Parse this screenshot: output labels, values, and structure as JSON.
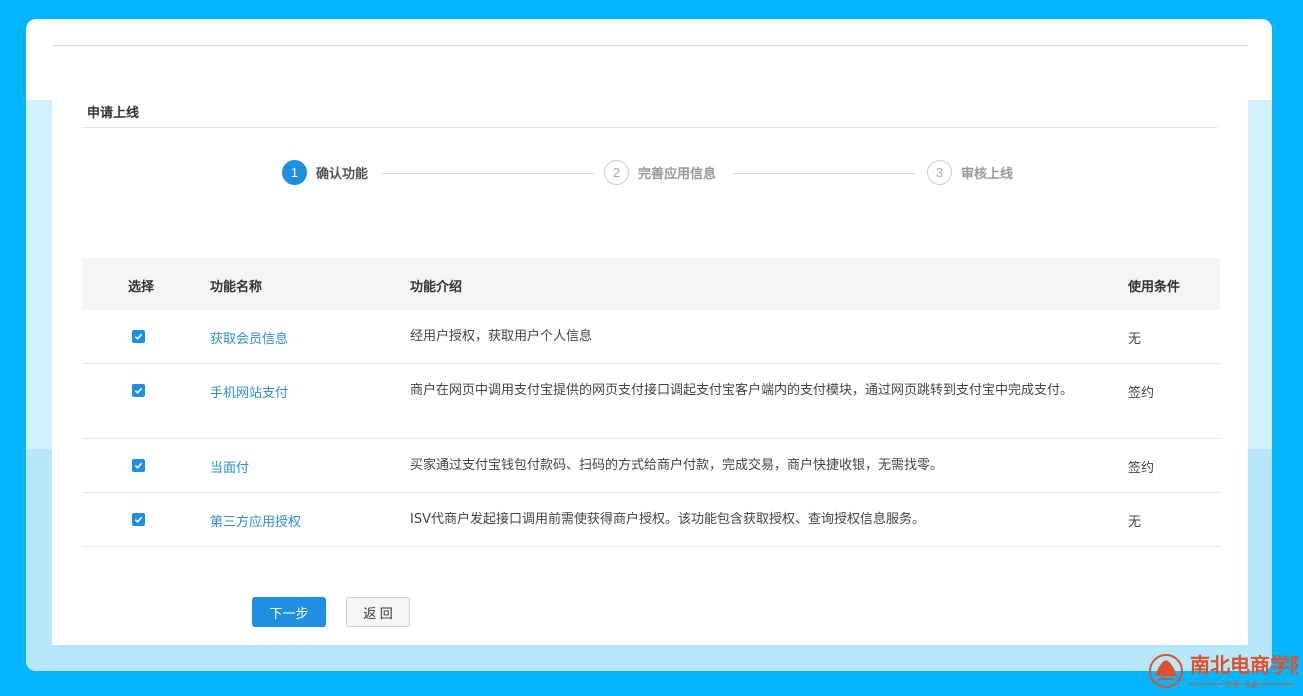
{
  "page": {
    "title": "申请上线"
  },
  "steps": [
    {
      "number": "1",
      "label": "确认功能",
      "state": "active"
    },
    {
      "number": "2",
      "label": "完善应用信息",
      "state": "inactive"
    },
    {
      "number": "3",
      "label": "审核上线",
      "state": "inactive"
    }
  ],
  "table": {
    "headers": {
      "select": "选择",
      "name": "功能名称",
      "desc": "功能介绍",
      "cond": "使用条件"
    },
    "rows": [
      {
        "checked": true,
        "name": "获取会员信息",
        "desc": "经用户授权，获取用户个人信息",
        "cond": "无"
      },
      {
        "checked": true,
        "name": "手机网站支付",
        "desc": "商户在网页中调用支付宝提供的网页支付接口调起支付宝客户端内的支付模块，通过网页跳转到支付宝中完成支付。",
        "cond": "签约"
      },
      {
        "checked": true,
        "name": "当面付",
        "desc": "买家通过支付宝钱包付款码、扫码的方式给商户付款，完成交易，商户快捷收银，无需找零。",
        "cond": "签约"
      },
      {
        "checked": true,
        "name": "第三方应用授权",
        "desc": "ISV代商户发起接口调用前需使获得商户授权。该功能包含获取授权、查询授权信息服务。",
        "cond": "无"
      }
    ]
  },
  "buttons": {
    "next": "下一步",
    "back": "返 回"
  },
  "watermark": {
    "brand": "南北电商学院",
    "slogan_left": "专注",
    "slogan_right": "专业"
  },
  "colors": {
    "background": "#05b5fb",
    "accent": "#1e8fe1",
    "link": "#2b8fd0",
    "logo": "#e0502a"
  }
}
